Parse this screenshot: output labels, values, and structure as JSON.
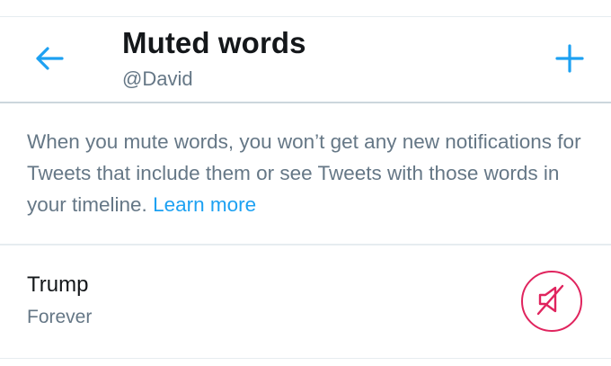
{
  "header": {
    "title": "Muted words",
    "subtitle": "@David",
    "back_icon": "arrow-left-icon",
    "add_icon": "plus-icon"
  },
  "description": {
    "text": "When you mute words, you won’t get any new notifications for Tweets that include them or see Tweets with those words in your timeline.",
    "learn_more": "Learn more"
  },
  "muted_words": [
    {
      "word": "Trump",
      "duration": "Forever",
      "icon": "speaker-muted-icon"
    }
  ],
  "colors": {
    "accent": "#1da1f2",
    "mute_red": "#e0245e",
    "text_primary": "#14171a",
    "text_secondary": "#657786",
    "divider": "#e6ecf0"
  }
}
